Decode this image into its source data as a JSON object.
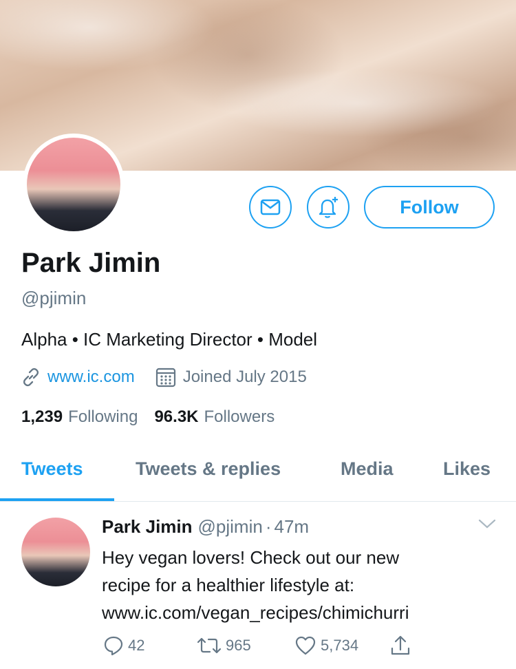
{
  "profile": {
    "name": "Park Jimin",
    "handle": "@pjimin",
    "bio": "Alpha • IC Marketing Director • Model",
    "website": "www.ic.com",
    "joined": "Joined July 2015",
    "following_count": "1,239",
    "following_label": "Following",
    "followers_count": "96.3K",
    "followers_label": "Followers"
  },
  "buttons": {
    "follow_label": "Follow"
  },
  "tabs": [
    {
      "label": "Tweets",
      "active": true
    },
    {
      "label": "Tweets & replies",
      "active": false
    },
    {
      "label": "Media",
      "active": false
    },
    {
      "label": "Likes",
      "active": false
    }
  ],
  "tweet": {
    "author": "Park Jimin",
    "handle": "@pjimin",
    "separator": "·",
    "time": "47m",
    "lines": [
      "Hey vegan lovers! Check out our new",
      "recipe for a healthier lifestyle at:",
      "www.ic.com/vegan_recipes/chimichurri"
    ],
    "replies": "42",
    "retweets": "965",
    "likes": "5,734"
  },
  "icons": {
    "message": "envelope-icon",
    "notify": "bell-plus-icon",
    "link": "link-icon",
    "calendar": "calendar-icon",
    "reply": "reply-icon",
    "retweet": "retweet-icon",
    "like": "heart-icon",
    "share": "share-icon",
    "caret": "chevron-down-icon"
  },
  "colors": {
    "accent": "#1da1f2",
    "secondary_text": "#657786",
    "link": "#1b95e0"
  }
}
